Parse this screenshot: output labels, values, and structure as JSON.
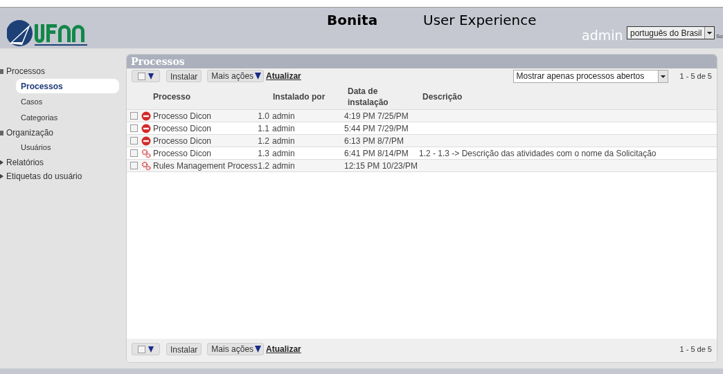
{
  "header": {
    "title": "Bonita",
    "subtitle": "User Experience",
    "user": "admin",
    "language": "português do Brasil",
    "cut_link": "So"
  },
  "sidebar": {
    "groups": [
      {
        "label": "Processos",
        "expanded": true,
        "children": [
          {
            "label": "Processos",
            "selected": true
          },
          {
            "label": "Casos",
            "selected": false
          },
          {
            "label": "Categorias",
            "selected": false
          }
        ]
      },
      {
        "label": "Organização",
        "expanded": true,
        "children": [
          {
            "label": "Usuários",
            "selected": false
          }
        ]
      },
      {
        "label": "Relatórios",
        "expanded": false
      },
      {
        "label": "Etiquetas do usuário",
        "expanded": false
      }
    ]
  },
  "panel": {
    "title": "Processos",
    "toolbar": {
      "install": "Instalar",
      "more": "Mais ações",
      "refresh": "Atualizar",
      "filter": "Mostrar apenas processos abertos",
      "paging": "1 - 5 de 5"
    },
    "table": {
      "columns": [
        "Processo",
        "Instalado por",
        "Data de instalação",
        "Descrição"
      ],
      "rows": [
        {
          "kind": "disabled",
          "checked": false,
          "name": "Processo Dicon",
          "version": "1.0",
          "by": "admin",
          "date": "4:19 PM 7/25/PM"
        },
        {
          "kind": "disabled",
          "checked": false,
          "name": "Processo Dicon",
          "version": "1.1",
          "by": "admin",
          "date": "5:44 PM 7/29/PM"
        },
        {
          "kind": "disabled",
          "checked": false,
          "name": "Processo Dicon",
          "version": "1.2",
          "by": "admin",
          "date": "6:13 PM 8/7/PM"
        },
        {
          "kind": "enabled",
          "checked": false,
          "name": "Processo Dicon",
          "version": "1.3",
          "by": "admin",
          "date": "6:41 PM 8/14/PM",
          "description": "1.2 - 1.3 -> Descrição das atividades com o nome da Solicitação"
        },
        {
          "kind": "enabled",
          "checked": false,
          "name": "Rules Management Process",
          "version": "1.2",
          "by": "admin",
          "date": "12:15 PM 10/23/PM"
        }
      ]
    },
    "bottom_toolbar": {
      "install": "Instalar",
      "more": "Mais ações",
      "refresh": "Atualizar",
      "paging": "1 - 5 de 5"
    }
  }
}
